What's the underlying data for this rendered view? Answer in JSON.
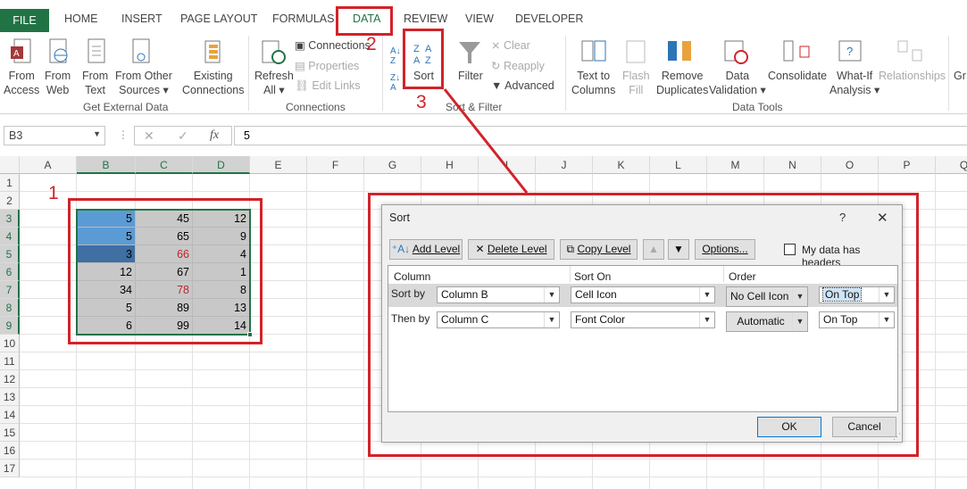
{
  "tabs": {
    "file": "FILE",
    "home": "HOME",
    "insert": "INSERT",
    "page_layout": "PAGE LAYOUT",
    "formulas": "FORMULAS",
    "data": "DATA",
    "review": "REVIEW",
    "view": "VIEW",
    "developer": "DEVELOPER"
  },
  "ribbon": {
    "from_access": "From\nAccess",
    "from_web": "From\nWeb",
    "from_text": "From\nText",
    "from_other": "From Other\nSources ▾",
    "existing": "Existing\nConnections",
    "group_external": "Get External Data",
    "refresh_all": "Refresh\nAll ▾",
    "connections": "Connections",
    "properties": "Properties",
    "edit_links": "Edit Links",
    "group_connections": "Connections",
    "sort": "Sort",
    "filter": "Filter",
    "clear": "Clear",
    "reapply": "Reapply",
    "advanced": "Advanced",
    "group_sort": "Sort & Filter",
    "text_to_columns": "Text to\nColumns",
    "flash_fill": "Flash\nFill",
    "remove_duplicates": "Remove\nDuplicates",
    "data_validation": "Data\nValidation ▾",
    "consolidate": "Consolidate",
    "what_if": "What-If\nAnalysis ▾",
    "relationships": "Relationships",
    "group_tools": "Data Tools",
    "gr": "Gr"
  },
  "formula_bar": {
    "name_box": "B3",
    "value": "5",
    "fx": "fx"
  },
  "columns": [
    "A",
    "B",
    "C",
    "D",
    "E",
    "F",
    "G",
    "H",
    "I",
    "J",
    "K",
    "L",
    "M",
    "N",
    "O",
    "P",
    "Q"
  ],
  "rows": [
    "1",
    "2",
    "3",
    "4",
    "5",
    "6",
    "7",
    "8",
    "9",
    "10",
    "11",
    "12",
    "13",
    "14",
    "15",
    "16",
    "17"
  ],
  "cells": [
    [
      "5",
      "45",
      "12"
    ],
    [
      "5",
      "65",
      "9"
    ],
    [
      "3",
      "66",
      "4"
    ],
    [
      "12",
      "67",
      "1"
    ],
    [
      "34",
      "78",
      "8"
    ],
    [
      "5",
      "89",
      "13"
    ],
    [
      "6",
      "99",
      "14"
    ]
  ],
  "annotations": {
    "n1": "1",
    "n2": "2",
    "n3": "3"
  },
  "colors": {
    "accent": "#217346",
    "annotation": "#d2232a",
    "cell_blue": "#5b9bd5",
    "cell_dark_blue": "#3f6fa3",
    "cell_gray": "#c8c8c8",
    "red_text": "#c0262d"
  },
  "dialog": {
    "title": "Sort",
    "help": "?",
    "close": "✕",
    "add_level": "Add Level",
    "delete_level": "Delete Level",
    "copy_level": "Copy Level",
    "options": "Options...",
    "headers_label": "My data has headers",
    "col_header": "Column",
    "sort_on_header": "Sort On",
    "order_header": "Order",
    "rows": [
      {
        "label": "Sort by",
        "column": "Column B",
        "sort_on": "Cell Icon",
        "order1": "No Cell Icon",
        "order2": "On Top"
      },
      {
        "label": "Then by",
        "column": "Column C",
        "sort_on": "Font Color",
        "order1": "Automatic",
        "order2": "On Top"
      }
    ],
    "ok": "OK",
    "cancel": "Cancel"
  }
}
